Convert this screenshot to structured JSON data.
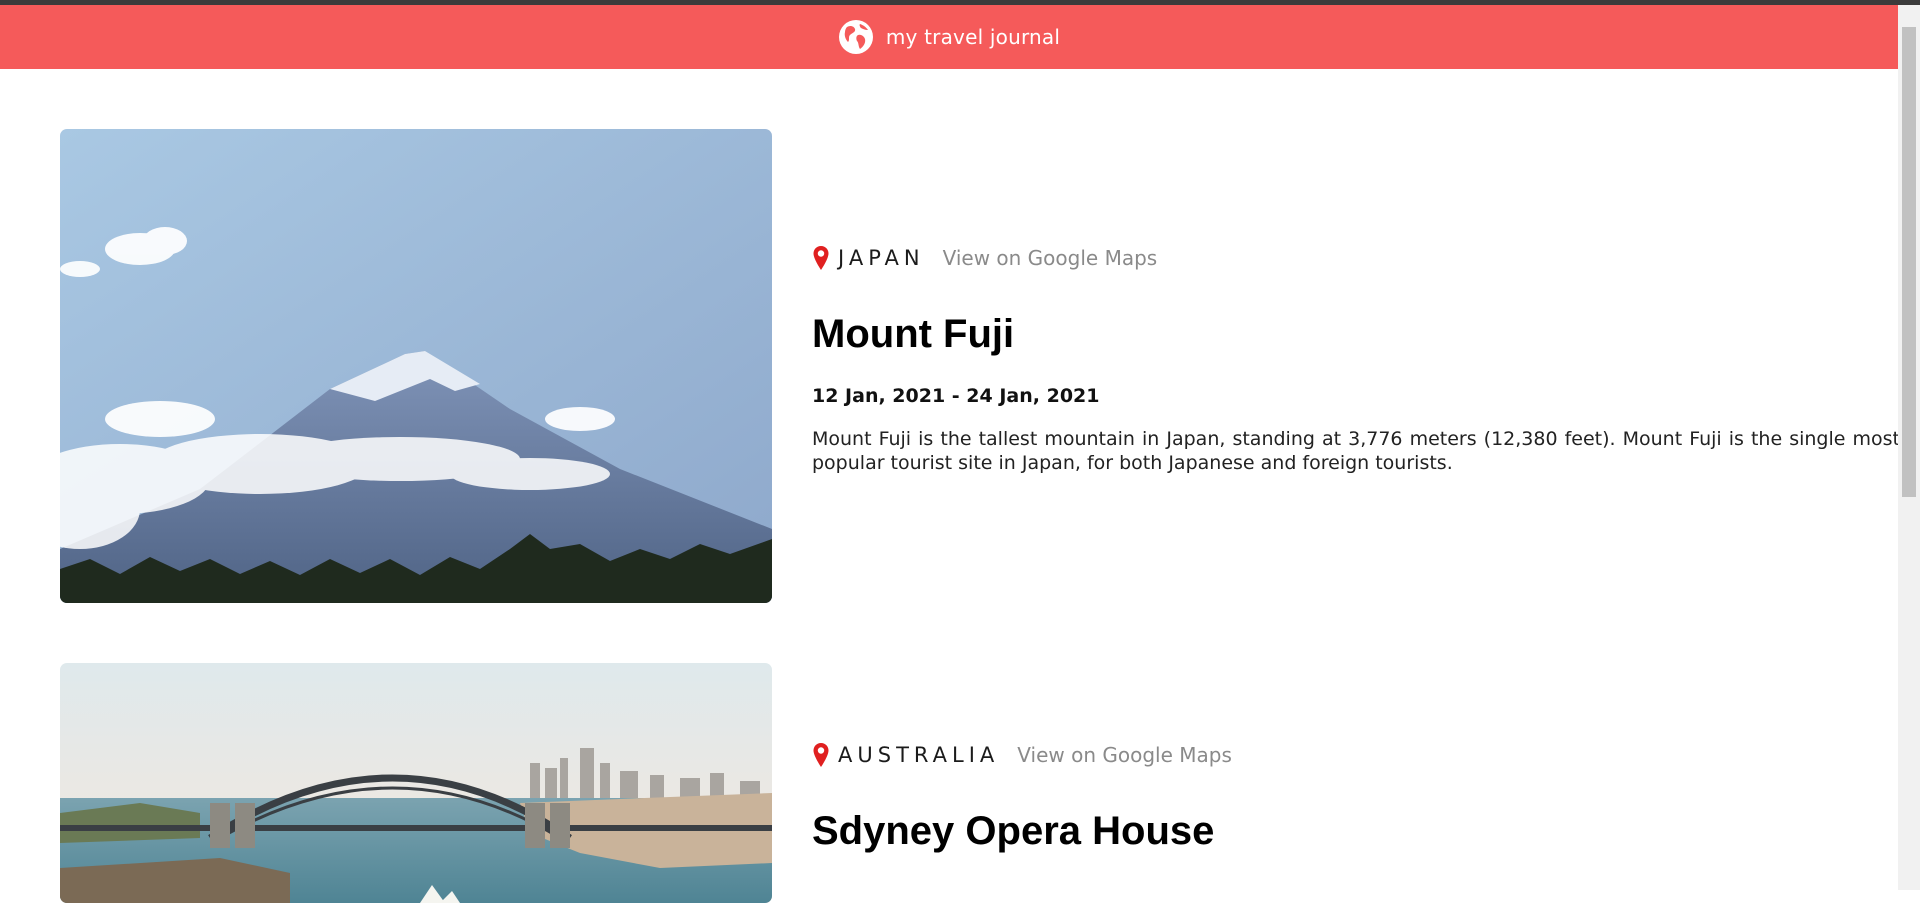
{
  "header": {
    "title": "my travel journal",
    "logo_icon": "globe-icon",
    "background": "#f55a5a"
  },
  "entries": [
    {
      "country": "JAPAN",
      "maps_link": "View on Google Maps",
      "place": "Mount Fuji",
      "dates": "12 Jan, 2021 - 24 Jan, 2021",
      "description": "Mount Fuji is the tallest mountain in Japan, standing at 3,776 meters (12,380 feet). Mount Fuji is the single most popular tourist site in Japan, for both Japanese and foreign tourists.",
      "pin_icon": "location-pin-icon"
    },
    {
      "country": "AUSTRALIA",
      "maps_link": "View on Google Maps",
      "place": "Sdyney Opera House",
      "pin_icon": "location-pin-icon"
    }
  ],
  "colors": {
    "accent": "#f55a5a",
    "pin": "#e02020",
    "link": "#8a8a8a"
  }
}
